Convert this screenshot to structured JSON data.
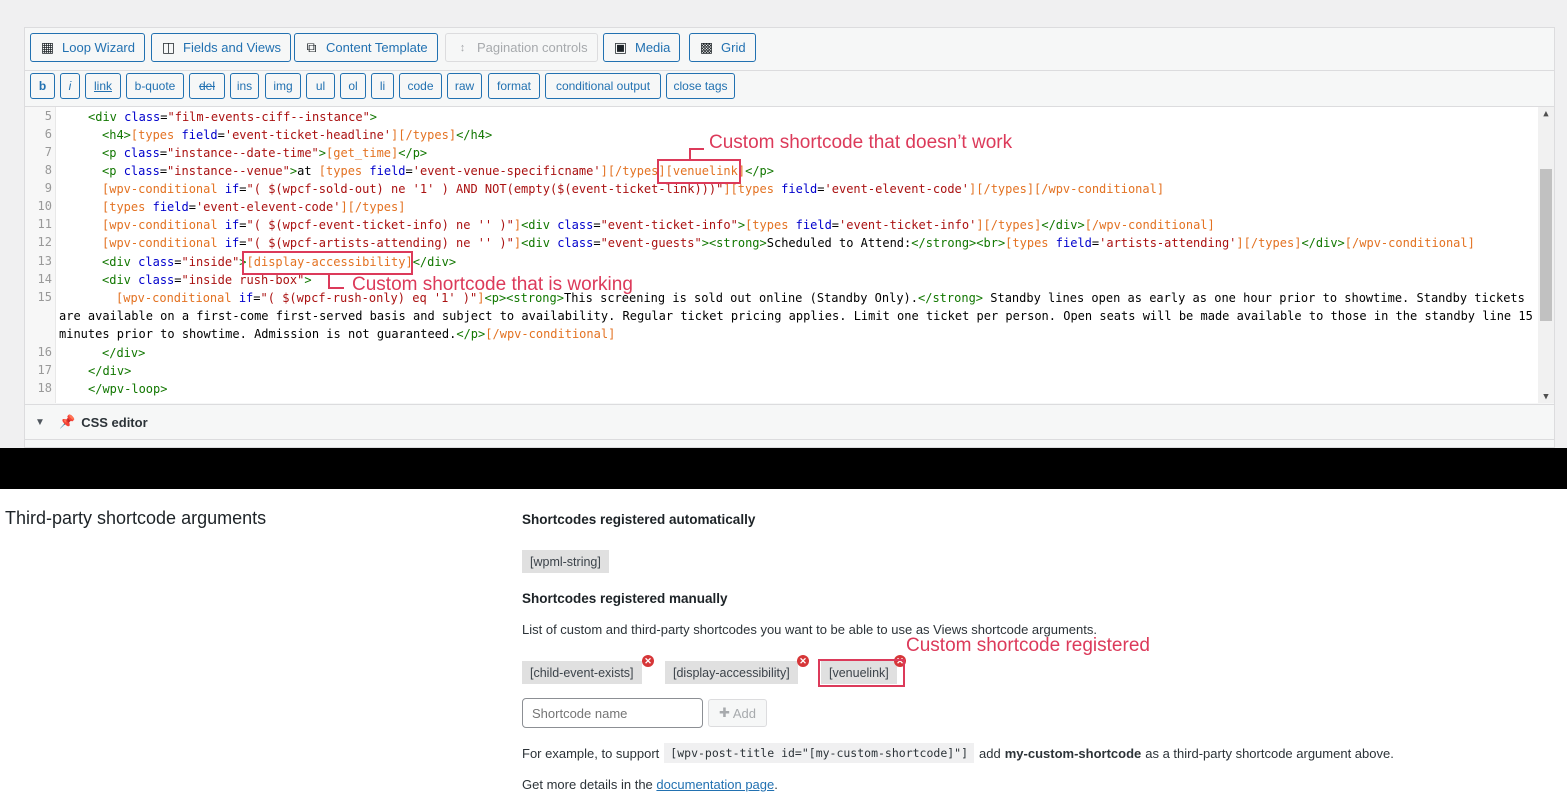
{
  "toolbar": {
    "buttons": [
      {
        "label": "Loop Wizard",
        "icon": "grid-icon"
      },
      {
        "label": "Fields and Views",
        "icon": "fields-icon"
      },
      {
        "label": "Content Template",
        "icon": "copy-icon"
      },
      {
        "label": "Pagination controls",
        "icon": "pagination-icon",
        "disabled": true
      },
      {
        "label": "Media",
        "icon": "image-icon"
      },
      {
        "label": "Grid",
        "icon": "bootstrap-icon"
      }
    ]
  },
  "quicktags": [
    "b",
    "i",
    "link",
    "b-quote",
    "del",
    "ins",
    "img",
    "ul",
    "ol",
    "li",
    "code",
    "raw",
    "format",
    "conditional output",
    "close tags"
  ],
  "editor": {
    "line_numbers": [
      "5",
      "6",
      "7",
      "8",
      "9",
      "10",
      "11",
      "12",
      "13",
      "14",
      "15",
      "16",
      "17",
      "18"
    ],
    "css_editor_label": "CSS editor"
  },
  "annotations": {
    "not_working": "Custom shortcode that doesn’t work",
    "working": "Custom shortcode that is working",
    "registered": "Custom shortcode registered"
  },
  "settings": {
    "section_title": "Third-party shortcode arguments",
    "auto_heading": "Shortcodes registered automatically",
    "auto_shortcodes": [
      "[wpml-string]"
    ],
    "manual_heading": "Shortcodes registered manually",
    "manual_description": "List of custom and third-party shortcodes you want to be able to use as Views shortcode arguments.",
    "manual_shortcodes": [
      "[child-event-exists]",
      "[display-accessibility]",
      "[venuelink]"
    ],
    "input_placeholder": "Shortcode name",
    "add_label": "Add",
    "example_prefix": "For example, to support",
    "example_code": "[wpv-post-title id=\"[my-custom-shortcode]\"]",
    "example_middle": "add",
    "example_bold": "my-custom-shortcode",
    "example_suffix": "as a third-party shortcode argument above.",
    "more_prefix": "Get more details in the",
    "more_link": "documentation page",
    "more_suffix": "."
  }
}
